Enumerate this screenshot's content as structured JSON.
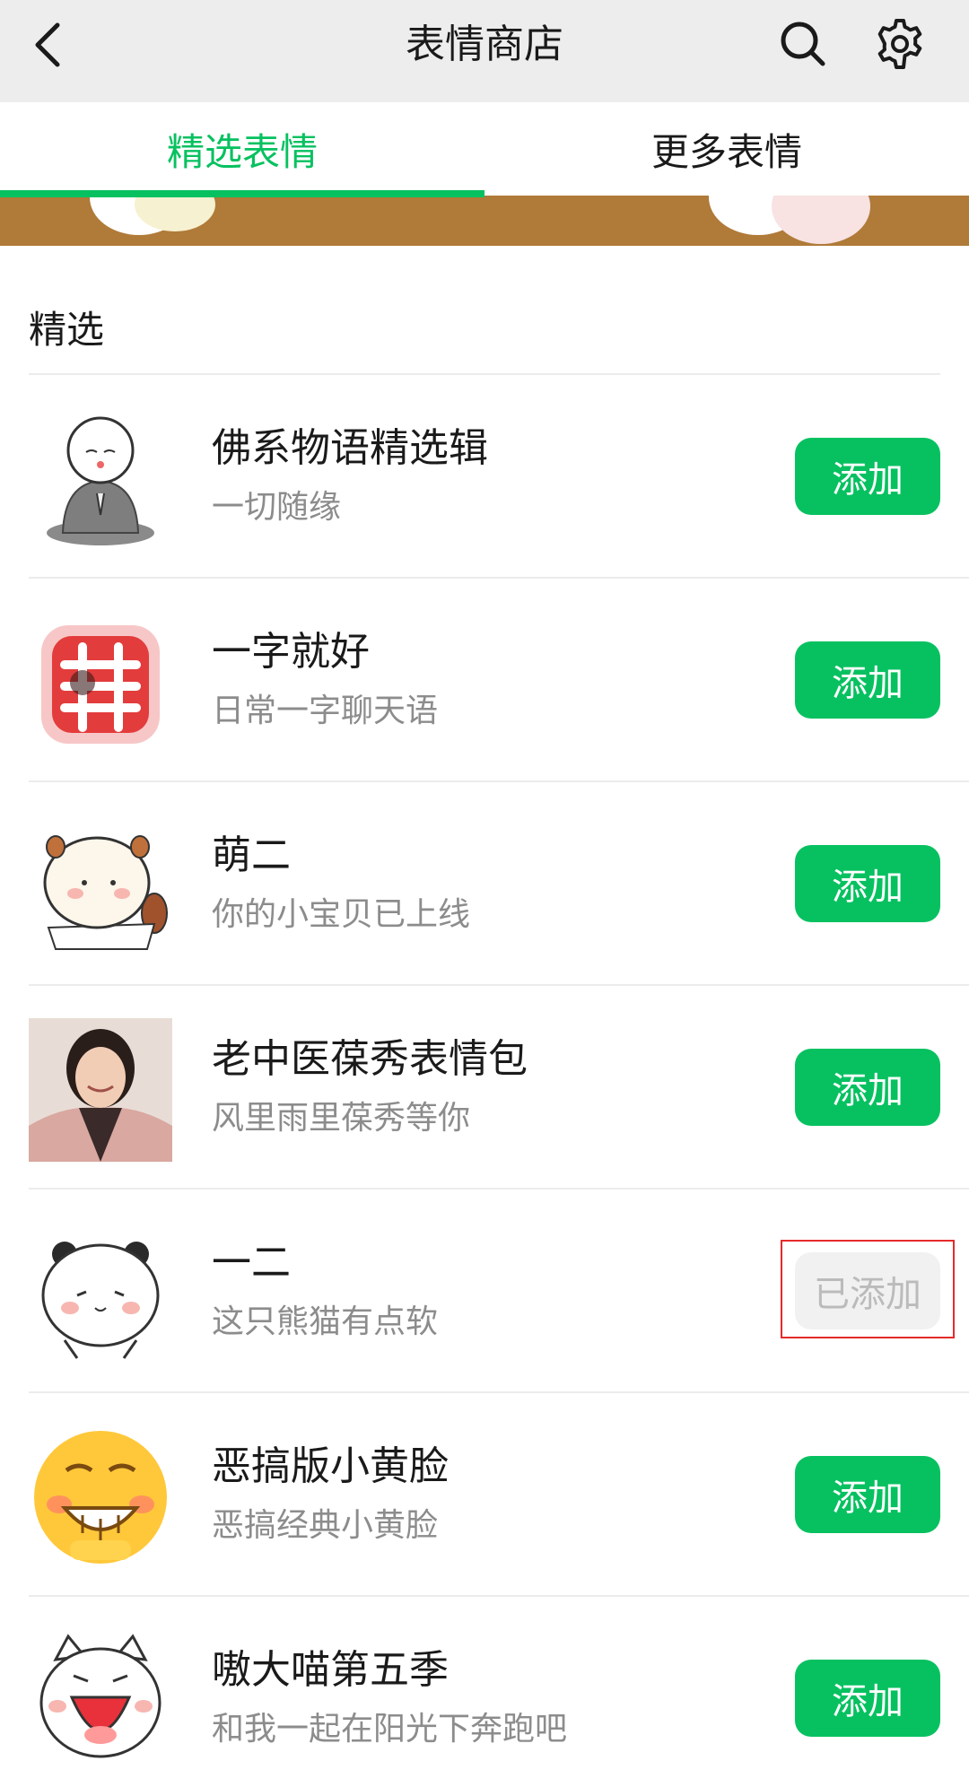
{
  "header": {
    "title": "表情商店",
    "icons": {
      "back": "back-icon",
      "search": "search-icon",
      "settings": "gear-icon"
    }
  },
  "tabs": [
    {
      "label": "精选表情",
      "active": true
    },
    {
      "label": "更多表情",
      "active": false
    }
  ],
  "section": {
    "title": "精选"
  },
  "colors": {
    "accent": "#07c160",
    "highlight": "#e52a2a",
    "header_bg": "#ededed"
  },
  "items": [
    {
      "title": "佛系物语精选辑",
      "subtitle": "一切随缘",
      "button": "添加",
      "added": false
    },
    {
      "title": "一字就好",
      "subtitle": "日常一字聊天语",
      "button": "添加",
      "added": false
    },
    {
      "title": "萌二",
      "subtitle": "你的小宝贝已上线",
      "button": "添加",
      "added": false
    },
    {
      "title": "老中医葆秀表情包",
      "subtitle": "风里雨里葆秀等你",
      "button": "添加",
      "added": false
    },
    {
      "title": "一二",
      "subtitle": "这只熊猫有点软",
      "button": "已添加",
      "added": true
    },
    {
      "title": "恶搞版小黄脸",
      "subtitle": "恶搞经典小黄脸",
      "button": "添加",
      "added": false
    },
    {
      "title": "嗷大喵第五季",
      "subtitle": "和我一起在阳光下奔跑吧",
      "button": "添加",
      "added": false
    }
  ]
}
